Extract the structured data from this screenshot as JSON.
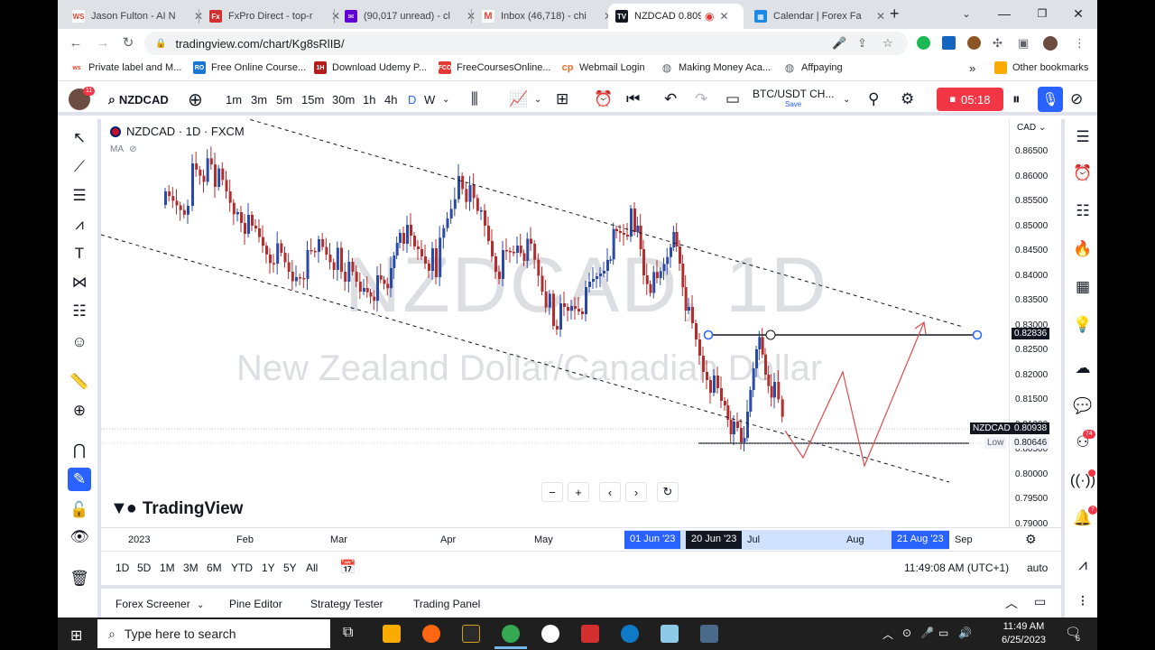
{
  "browser": {
    "tabs": [
      {
        "title": "Jason Fulton - AI N",
        "fav": "WS",
        "color": "#e6442e"
      },
      {
        "title": "FxPro Direct - top-r",
        "fav": "Fx",
        "color": "#d32f2f"
      },
      {
        "title": "(90,017 unread) - cl",
        "fav": "✉",
        "color": "#6001d2"
      },
      {
        "title": "Inbox (46,718) - chi",
        "fav": "M",
        "color": "#ea4335"
      },
      {
        "title": "NZDCAD 0.809",
        "fav": "TV",
        "color": "#131722"
      },
      {
        "title": "Calendar | Forex Fa",
        "fav": "▦",
        "color": "#1e88e5"
      }
    ],
    "url": "tradingview.com/chart/Kg8sRlIB/",
    "bookmarks": [
      {
        "label": "Private label and M...",
        "icon": "ws"
      },
      {
        "label": "Free Online Course...",
        "icon": "RO"
      },
      {
        "label": "Download Udemy P...",
        "icon": "1H"
      },
      {
        "label": "FreeCoursesOnline...",
        "icon": "FCO"
      },
      {
        "label": "Webmail Login",
        "icon": "cp"
      },
      {
        "label": "Making Money Aca...",
        "icon": "globe"
      },
      {
        "label": "Affpaying",
        "icon": "globe"
      }
    ],
    "other_bookmarks": "Other bookmarks",
    "more": "»"
  },
  "toolbar": {
    "avatar_badge": "11",
    "symbol": "NZDCAD",
    "intervals": [
      "1m",
      "3m",
      "5m",
      "15m",
      "30m",
      "1h",
      "4h",
      "D",
      "W"
    ],
    "active_interval": "D",
    "layout_name": "BTC/USDT CH...",
    "layout_sub": "Save",
    "record_time": "05:18"
  },
  "chart": {
    "legend": "NZDCAD · 1D · FXCM",
    "ma": "MA",
    "watermark_symbol": "NZDCAD, 1D",
    "watermark_name": "New Zealand Dollar/Canadian Dollar",
    "logo": "TradingView",
    "currency": "CAD",
    "price_ticks": [
      "0.86500",
      "0.86000",
      "0.85500",
      "0.85000",
      "0.84500",
      "0.84000",
      "0.83500",
      "0.83000",
      "0.82500",
      "0.82000",
      "0.81500",
      "0.81000",
      "0.80500",
      "0.80000",
      "0.79500",
      "0.79000"
    ],
    "hline_label": "0.82836",
    "symbol_label": "NZDCAD",
    "last_price": "0.80938",
    "low_label": "Low",
    "low_price": "0.80646",
    "time_ticks": [
      "2023",
      "Feb",
      "Mar",
      "Apr",
      "May",
      "Jul",
      "Aug",
      "Sep"
    ],
    "time_highlights": [
      "01 Jun '23",
      "20 Jun '23",
      "21 Aug '23"
    ],
    "colors": {
      "up": "#2a4aa8",
      "down": "#b22d2d",
      "projection": "#e04b4b"
    }
  },
  "ranges": [
    "1D",
    "5D",
    "1M",
    "3M",
    "6M",
    "YTD",
    "1Y",
    "5Y",
    "All"
  ],
  "clock": "11:49:08 AM (UTC+1)",
  "auto": "auto",
  "bottom_tabs": [
    "Forex Screener",
    "Pine Editor",
    "Strategy Tester",
    "Trading Panel"
  ],
  "taskbar": {
    "search": "Type here to search",
    "time": "11:49 AM",
    "date": "6/25/2023",
    "notif": "6"
  }
}
